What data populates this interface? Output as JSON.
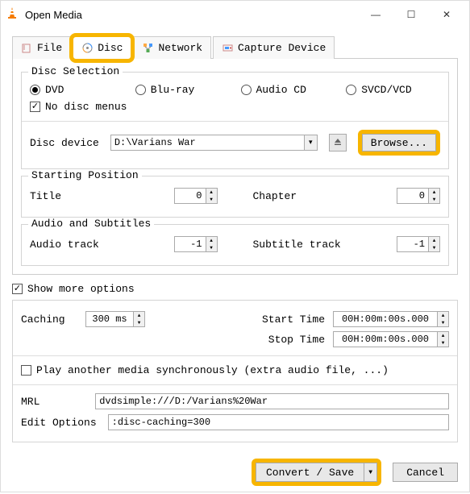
{
  "window": {
    "title": "Open Media"
  },
  "tabs": {
    "file": "File",
    "disc": "Disc",
    "network": "Network",
    "capture": "Capture Device"
  },
  "disc_selection": {
    "title": "Disc Selection",
    "dvd": "DVD",
    "bluray": "Blu-ray",
    "audiocd": "Audio CD",
    "svcd": "SVCD/VCD",
    "no_menus": "No disc menus",
    "device_label": "Disc device",
    "device_value": "D:\\Varians War",
    "browse": "Browse..."
  },
  "starting": {
    "title": "Starting Position",
    "title_label": "Title",
    "title_value": "0",
    "chapter_label": "Chapter",
    "chapter_value": "0"
  },
  "audio": {
    "title": "Audio and Subtitles",
    "track_label": "Audio track",
    "track_value": "-1",
    "sub_label": "Subtitle track",
    "sub_value": "-1"
  },
  "show_more": "Show more options",
  "more": {
    "caching_label": "Caching",
    "caching_value": "300 ms",
    "start_label": "Start Time",
    "start_value": "00H:00m:00s.000",
    "stop_label": "Stop Time",
    "stop_value": "00H:00m:00s.000",
    "play_sync": "Play another media synchronously (extra audio file, ...)",
    "mrl_label": "MRL",
    "mrl_value": "dvdsimple:///D:/Varians%20War",
    "edit_label": "Edit Options",
    "edit_value": ":disc-caching=300"
  },
  "footer": {
    "convert": "Convert / Save",
    "cancel": "Cancel"
  }
}
